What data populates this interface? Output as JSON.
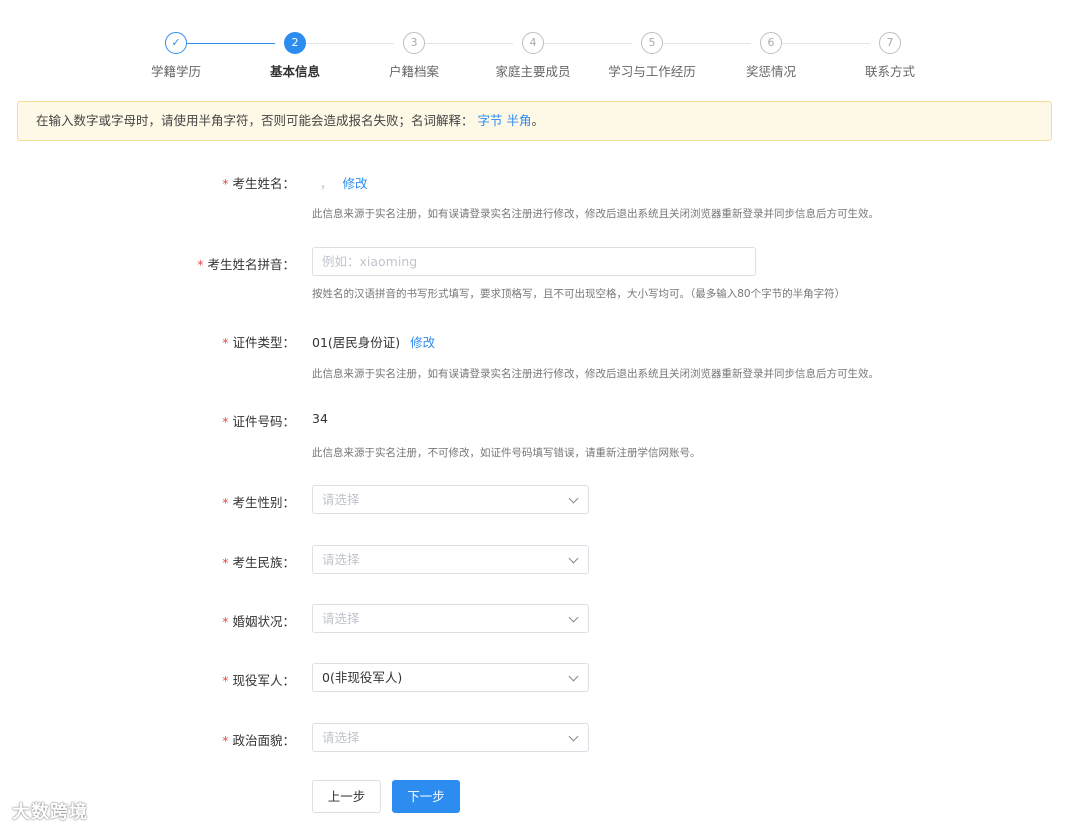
{
  "stepper": {
    "steps": [
      {
        "label": "学籍学历",
        "state": "done",
        "icon": "check-icon"
      },
      {
        "label": "基本信息",
        "state": "active",
        "number": "2"
      },
      {
        "label": "户籍档案",
        "state": "pending",
        "number": "3"
      },
      {
        "label": "家庭主要成员",
        "state": "pending",
        "number": "4"
      },
      {
        "label": "学习与工作经历",
        "state": "pending",
        "number": "5"
      },
      {
        "label": "奖惩情况",
        "state": "pending",
        "number": "6"
      },
      {
        "label": "联系方式",
        "state": "pending",
        "number": "7"
      }
    ]
  },
  "notice": {
    "text": "在输入数字或字母时，请使用半角字符，否则可能会造成报名失败；名词解释：",
    "link_fullwidth": "字节",
    "link_halfwidth": "半角",
    "suffix": "。"
  },
  "form": {
    "name": {
      "label": "考生姓名：",
      "value": "，",
      "edit_link": "修改",
      "help": "此信息来源于实名注册，如有误请登录实名注册进行修改，修改后退出系统且关闭浏览器重新登录并同步信息后方可生效。"
    },
    "pinyin": {
      "label": "考生姓名拼音：",
      "placeholder": "例如：xiaoming",
      "help": "按姓名的汉语拼音的书写形式填写，要求顶格写，且不可出现空格，大小写均可。（最多输入80个字节的半角字符）"
    },
    "id_type": {
      "label": "证件类型：",
      "value": "01(居民身份证)",
      "edit_link": "修改",
      "help": "此信息来源于实名注册，如有误请登录实名注册进行修改，修改后退出系统且关闭浏览器重新登录并同步信息后方可生效。"
    },
    "id_number": {
      "label": "证件号码：",
      "value": "34",
      "help": "此信息来源于实名注册，不可修改，如证件号码填写错误，请重新注册学信网账号。"
    },
    "gender": {
      "label": "考生性别：",
      "value": "请选择"
    },
    "ethnicity": {
      "label": "考生民族：",
      "value": "请选择"
    },
    "marital": {
      "label": "婚姻状况：",
      "value": "请选择"
    },
    "military": {
      "label": "现役军人：",
      "value": "0(非现役军人)"
    },
    "political": {
      "label": "政治面貌：",
      "value": "请选择"
    },
    "required_mark": "*"
  },
  "buttons": {
    "prev": "上一步",
    "next": "下一步"
  },
  "watermark": {
    "text": "大数跨境"
  },
  "colors": {
    "primary": "#2d8cf0",
    "required": "#e34a4a",
    "notice_bg": "#fef8e7",
    "notice_border": "#f5dc97"
  }
}
